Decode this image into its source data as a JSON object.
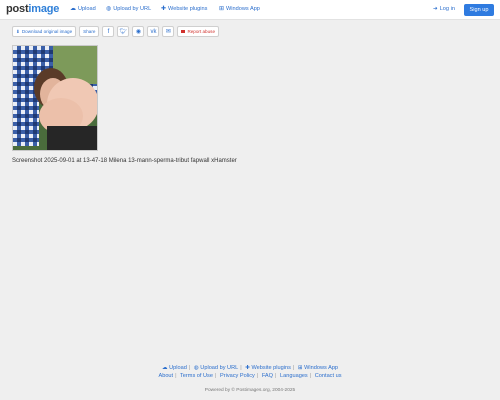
{
  "header": {
    "logo_main": "post",
    "logo_accent": "image",
    "nav": {
      "upload": "Upload",
      "upload_by_url": "Upload by URL",
      "website_plugins": "Website plugins",
      "windows_app": "Windows App"
    },
    "login": "Log in",
    "signup": "Sign up"
  },
  "toolbar": {
    "download": "Download original image",
    "share": "Share",
    "report": "Report abuse"
  },
  "image": {
    "caption": "Screenshot 2025-09-01 at 13-47-18 Milena 13-mann-sperma-tribut fapwall xHamster"
  },
  "footer": {
    "row1": {
      "upload": "Upload",
      "upload_by_url": "Upload by URL",
      "website_plugins": "Website plugins",
      "windows_app": "Windows App"
    },
    "row2": {
      "about": "About",
      "terms": "Terms of Use",
      "privacy": "Privacy Policy",
      "faq": "FAQ",
      "languages": "Languages",
      "contact": "Contact us"
    },
    "copyright": "Powered by © Postimages.org, 2004-2025"
  },
  "colors": {
    "accent": "#2c6fcd",
    "signup_bg": "#2f7be0",
    "report": "#d0312d",
    "page_bg": "#efefef"
  },
  "icons": {
    "upload": "cloud-upload-icon",
    "url": "globe-icon",
    "plugins": "puzzle-icon",
    "windows": "windows-icon",
    "login": "login-icon",
    "download": "download-icon",
    "facebook": "facebook-icon",
    "twitter": "twitter-icon",
    "reddit": "reddit-icon",
    "vk": "vk-icon",
    "email": "envelope-icon",
    "flag": "flag-icon"
  }
}
